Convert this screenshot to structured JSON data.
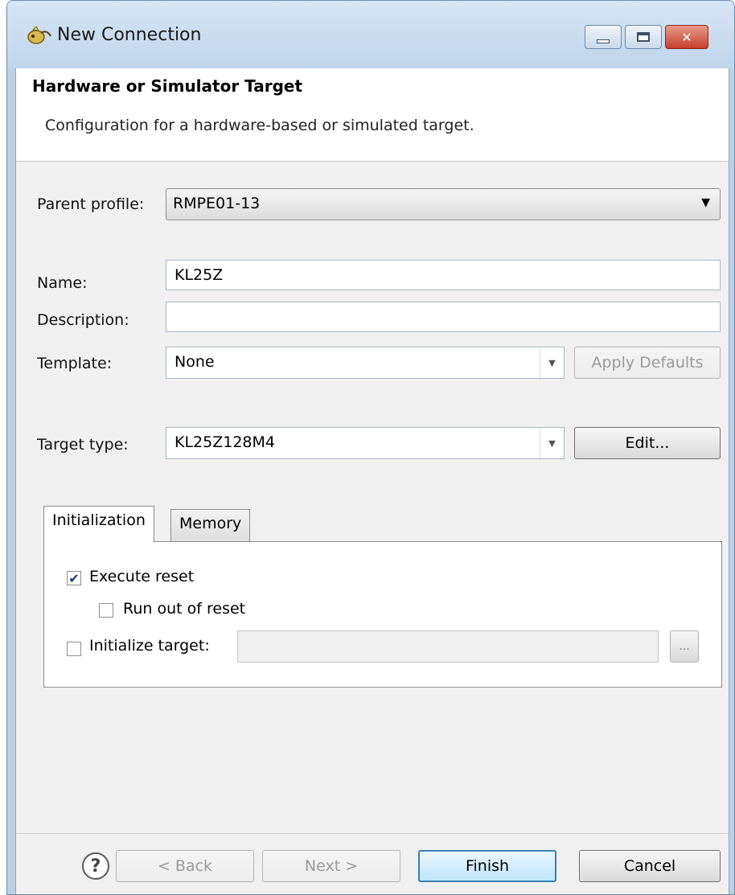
{
  "window": {
    "title": "New Connection",
    "close_glyph": "✕"
  },
  "banner": {
    "title": "Hardware or Simulator Target",
    "description": "Configuration for a hardware-based or simulated target."
  },
  "form": {
    "parent_profile_label": "Parent profile:",
    "parent_profile_value": "RMPE01-13",
    "name_label": "Name:",
    "name_value": "KL25Z",
    "description_label": "Description:",
    "description_value": "",
    "template_label": "Template:",
    "template_value": "None",
    "apply_defaults_label": "Apply Defaults",
    "target_type_label": "Target type:",
    "target_type_value": "KL25Z128M4",
    "edit_label": "Edit..."
  },
  "tabs": [
    {
      "label": "Initialization",
      "active": true
    },
    {
      "label": "Memory",
      "active": false
    }
  ],
  "initialization": {
    "execute_reset_label": "Execute reset",
    "execute_reset_checked": true,
    "run_out_of_reset_label": "Run out of reset",
    "run_out_of_reset_checked": false,
    "initialize_target_label": "Initialize target:",
    "initialize_target_checked": false,
    "initialize_target_path": "",
    "browse_label": "..."
  },
  "footer": {
    "help_glyph": "?",
    "back_label": "< Back",
    "next_label": "Next >",
    "finish_label": "Finish",
    "cancel_label": "Cancel"
  }
}
